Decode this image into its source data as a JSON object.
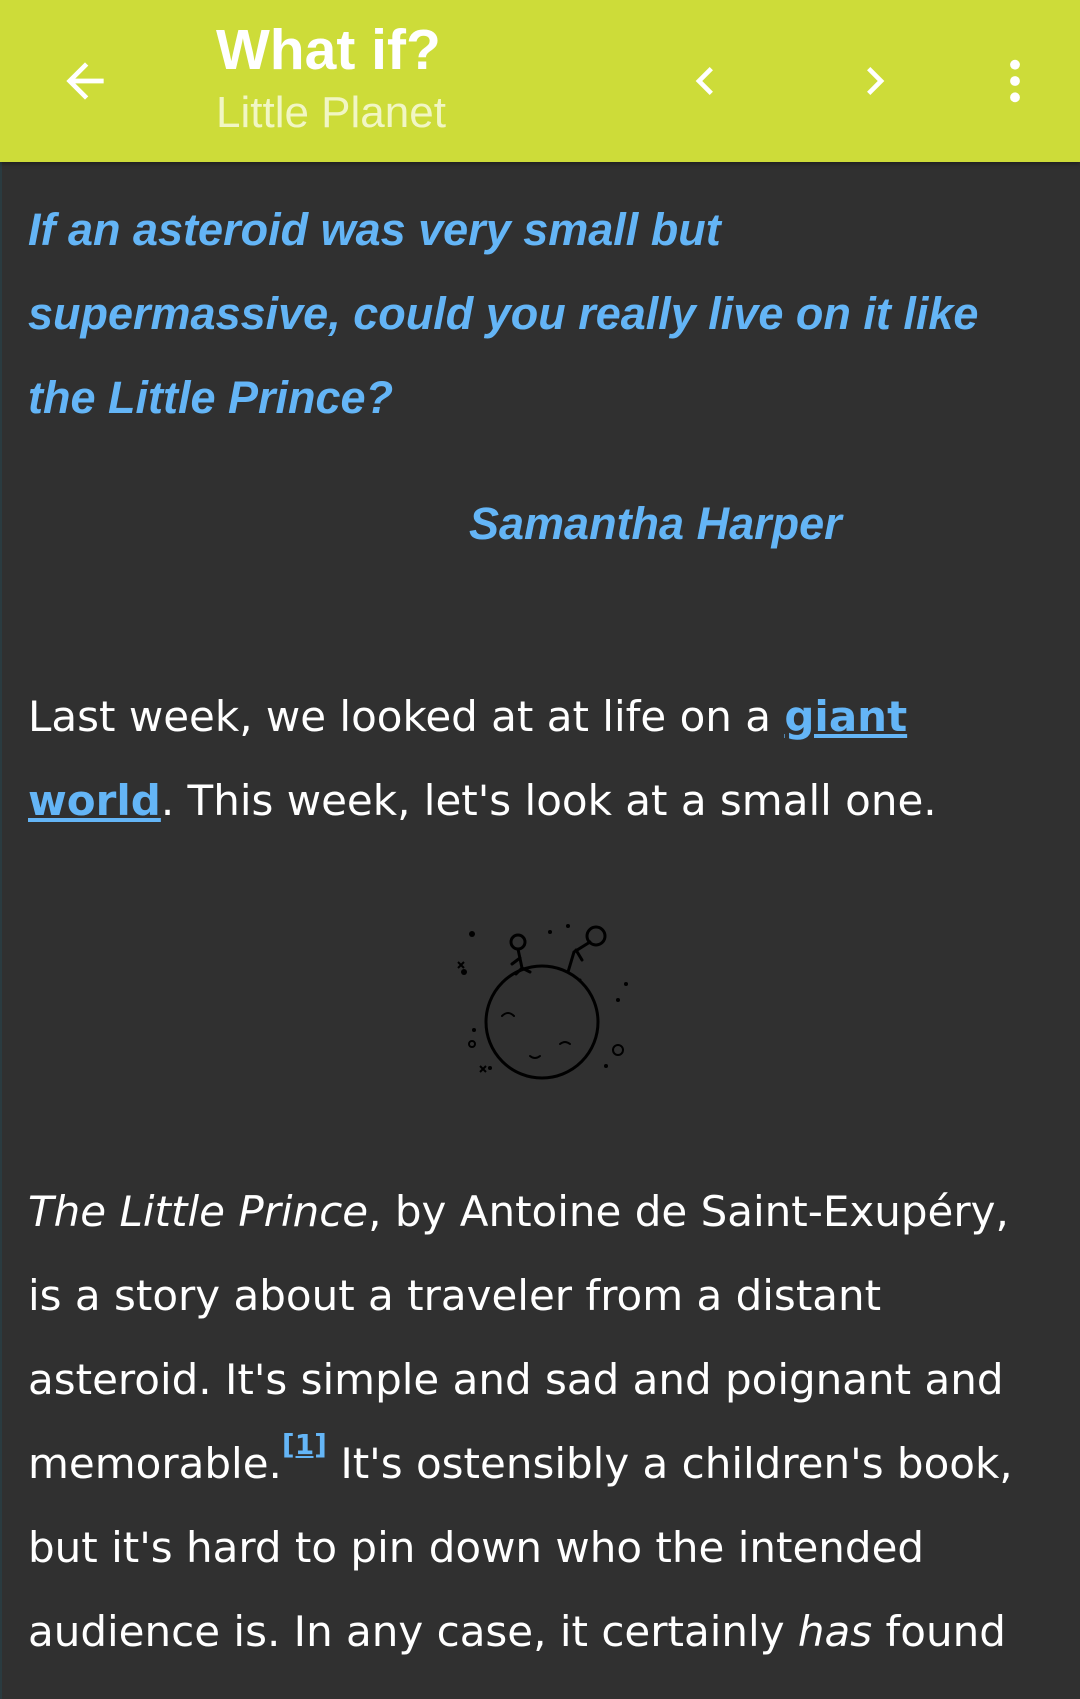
{
  "appbar": {
    "title": "What if?",
    "subtitle": "Little Planet",
    "background_color": "#cddc39",
    "icons": {
      "back": "arrow-left-icon",
      "prev": "chevron-left-icon",
      "next": "chevron-right-icon",
      "more": "more-vertical-icon"
    }
  },
  "article": {
    "question": "If an asteroid was very small but supermassive, could you really live on it like the Little Prince?",
    "asker": "Samantha Harper",
    "accent_color": "#64b5f6",
    "para1": {
      "before_link": "Last week, we looked at at life on a ",
      "link_text": "giant world",
      "after_link": ". This week, let's look at a small one."
    },
    "illustration": "little-prince-on-asteroid",
    "para2": {
      "book_title": "The Little Prince",
      "text1": ", by Antoine de Saint-Exupéry, is a story about a traveler from a distant asteroid. It's simple and sad and poignant and memorable.",
      "footnote": "[1]",
      "text2": " It's ostensibly a children's book, but it's hard to pin down who the intended audience is. In any case, it certainly ",
      "emphasis": "has",
      "text3": " found"
    }
  }
}
